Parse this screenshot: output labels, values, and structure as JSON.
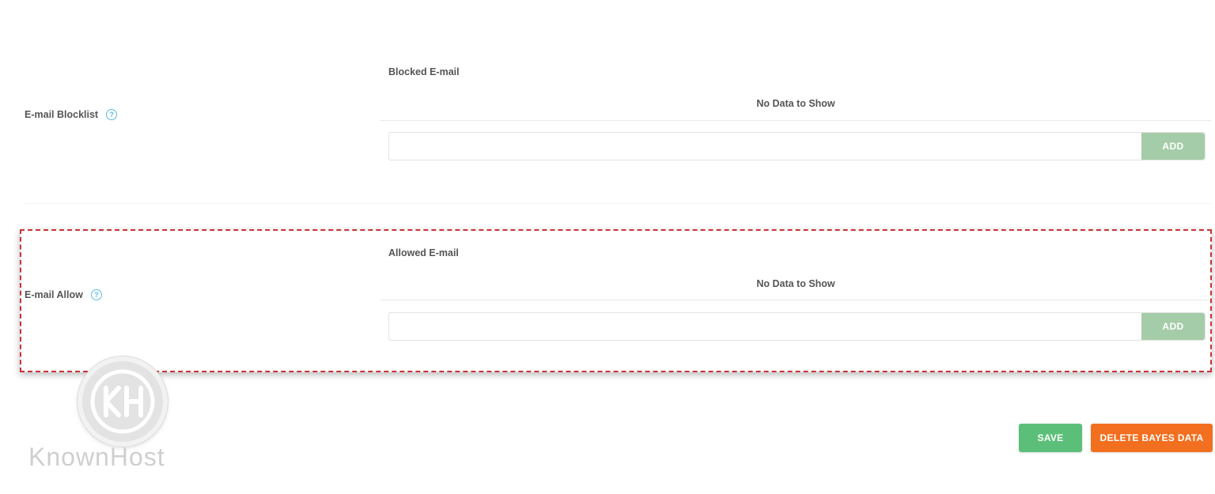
{
  "blocklist": {
    "label": "E-mail Blocklist",
    "help_icon": "question-circle-icon",
    "list_header": "Blocked E-mail",
    "empty_text": "No Data to Show",
    "input_value": "",
    "add_label": "ADD"
  },
  "allowlist": {
    "label": "E-mail Allow",
    "help_icon": "question-circle-icon",
    "list_header": "Allowed E-mail",
    "empty_text": "No Data to Show",
    "input_value": "",
    "add_label": "ADD"
  },
  "footer": {
    "save_label": "SAVE",
    "delete_label": "DELETE BAYES DATA"
  },
  "watermark": {
    "brand": "KnownHost"
  },
  "colors": {
    "help_icon": "#5bb9e6",
    "add_button": "#a5cca8",
    "save_button": "#5cbf79",
    "delete_button": "#f26f1f",
    "highlight_border": "#c8333a"
  }
}
